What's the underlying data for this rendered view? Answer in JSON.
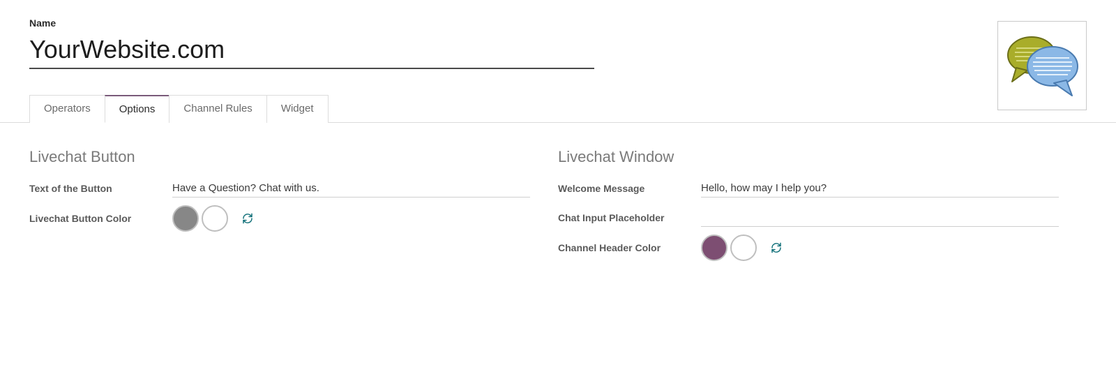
{
  "header": {
    "name_label": "Name",
    "name_value": "YourWebsite.com"
  },
  "tabs": [
    {
      "label": "Operators",
      "active": false
    },
    {
      "label": "Options",
      "active": true
    },
    {
      "label": "Channel Rules",
      "active": false
    },
    {
      "label": "Widget",
      "active": false
    }
  ],
  "options": {
    "button_section_title": "Livechat Button",
    "text_of_button_label": "Text of the Button",
    "text_of_button_value": "Have a Question? Chat with us.",
    "button_color_label": "Livechat Button Color",
    "button_color_primary": "#878787",
    "button_color_secondary": "#ffffff",
    "window_section_title": "Livechat Window",
    "welcome_message_label": "Welcome Message",
    "welcome_message_value": "Hello, how may I help you?",
    "chat_input_placeholder_label": "Chat Input Placeholder",
    "chat_input_placeholder_value": "",
    "header_color_label": "Channel Header Color",
    "header_color_primary": "#7d4e72",
    "header_color_secondary": "#ffffff"
  },
  "icons": {
    "refresh": "refresh-icon",
    "chat_bubble": "chat-bubble-icon"
  }
}
